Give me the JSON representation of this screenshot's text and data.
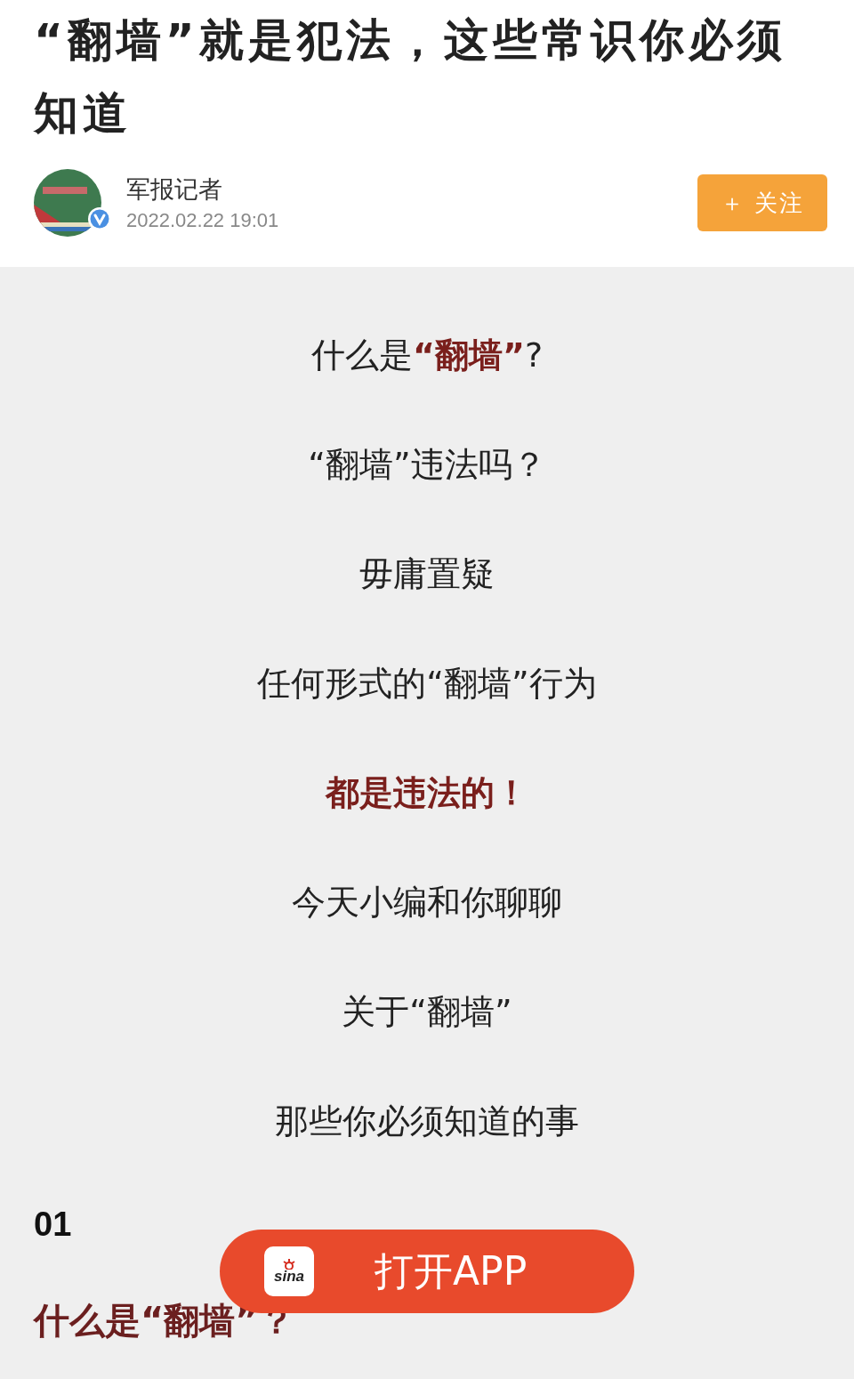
{
  "title": "“翻墙”就是犯法，这些常识你必须知道",
  "author": {
    "name": "军报记者",
    "time": "2022.02.22  19:01",
    "verified": true
  },
  "follow_button": "＋ 关注",
  "lines": [
    {
      "kind": "plain",
      "text": "什么是**“翻墙”**?"
    },
    {
      "kind": "plain",
      "text": "“翻墙”违法吗？"
    },
    {
      "kind": "plain",
      "text": "毋庸置疑"
    },
    {
      "kind": "plain",
      "text": "任何形式的“翻墙”行为"
    },
    {
      "kind": "emphasis",
      "text": "都是违法的！"
    },
    {
      "kind": "plain",
      "text": "今天小编和你聊聊"
    },
    {
      "kind": "plain",
      "text": "关于“翻墙”"
    },
    {
      "kind": "plain",
      "text": "那些你必须知道的事"
    }
  ],
  "section": {
    "number": "01",
    "heading": "什么是“翻墙”？"
  },
  "app_banner": {
    "logo_text": "sina",
    "label": "打开APP"
  }
}
